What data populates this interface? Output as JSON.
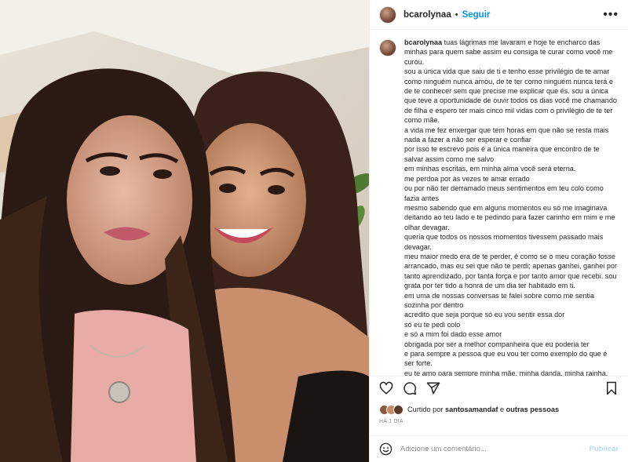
{
  "colors": {
    "accent": "#0095f6",
    "publish_disabled": "#b2dffc",
    "muted": "#8e8e8e",
    "text": "#262626"
  },
  "header": {
    "username": "bcarolynaa",
    "separator": "•",
    "follow_label": "Seguir",
    "more_icon": "more-horizontal-icon"
  },
  "caption": {
    "username": "bcarolynaa",
    "lines": [
      "tuas lágrimas me lavaram e hoje te encharco das minhas para quem sabe assim eu consiga te curar como você me curou.",
      "sou a única vida que saiu de ti e tenho esse privilégio de te amar como ninguém nunca amou, de te ter como ninguém nunca terá e de te conhecer sem que precise me explicar que és. sou a única que teve a oportunidade de ouvir todos os dias você me chamando de filha e espero ter mais cinco mil vidas com o privilégio de te ter como mãe.",
      "a vida me fez enxergar que tem horas em que não se resta mais nada a fazer a não ser esperar e confiar",
      "por isso te escrevo pois é a única maneira que encontro de te salvar assim como me salvo",
      "em minhas escritas, em minha alma você será eterna.",
      "me perdoa por às vezes te amar errado",
      "ou por não ter derramado meus sentimentos em teu colo como fazia antes",
      "mesmo sabendo que em alguns momentos eu só me imaginava deitando ao teu lado e te pedindo para fazer carinho em mim e me olhar devagar.",
      "queria que todos os nossos momentos tivessem passado mais devagar.",
      "meu maior medo era de te perder, é como se o meu coração fosse arrancado, mas eu sei que não te perdi; apenas ganhei, ganhei por tanto aprendizado, por tanta força e por tanto amor que recebi. sou grata por ter tido a honra de um dia ter habitado em ti.",
      "em uma de nossas conversas te falei sobre como me sentia sozinha por dentro",
      "acredito que seja porque só eu vou sentir essa dor",
      "só eu te pedi colo",
      "e só a mim foi dado esse amor",
      "obrigada por ser a melhor companheira que eu poderia ter",
      "e para sempre a pessoa que eu vou ter como exemplo do que é ser forte.",
      "eu te amo para sempre minha mãe, minha danda, minha rainha."
    ]
  },
  "actions": {
    "like_icon": "heart-icon",
    "comment_icon": "comment-icon",
    "share_icon": "share-icon",
    "save_icon": "bookmark-icon"
  },
  "likes": {
    "prefix": "Curtido por",
    "user": "santosamandaf",
    "connector": "e",
    "others": "outras pessoas"
  },
  "timestamp": "HÁ 1 DIA",
  "comment_box": {
    "emoji_icon": "emoji-icon",
    "placeholder": "Adicione um comentário...",
    "publish_label": "Publicar"
  }
}
